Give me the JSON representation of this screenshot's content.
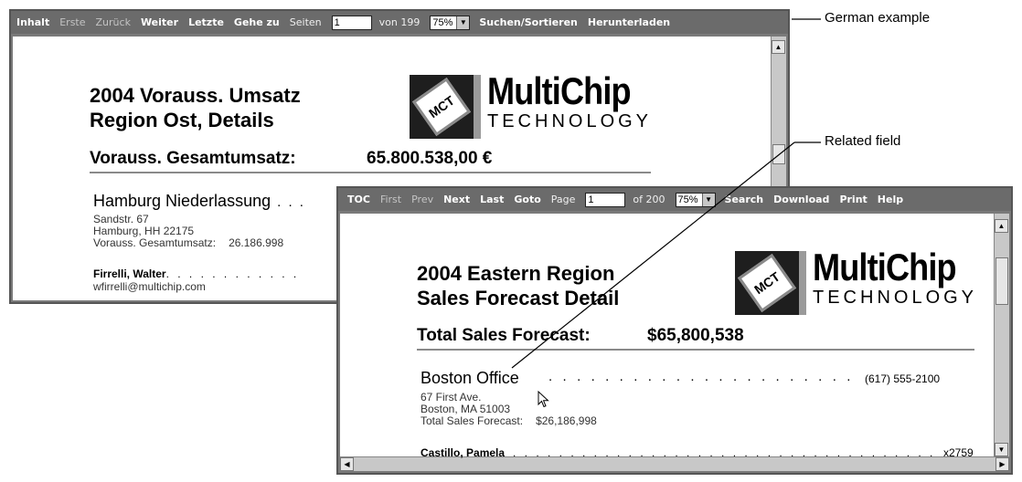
{
  "german_viewer": {
    "toolbar": {
      "toc": "Inhalt",
      "first": "Erste",
      "prev": "Zurück",
      "next": "Weiter",
      "last": "Letzte",
      "goto": "Gehe zu",
      "page_label": "Seiten",
      "page_value": "1",
      "of_label": "von 199",
      "zoom": "75%",
      "search": "Suchen/Sortieren",
      "download": "Herunterladen"
    },
    "doc": {
      "title_line1": "2004 Vorauss. Umsatz",
      "title_line2": "Region Ost, Details",
      "total_label": "Vorauss. Gesamtumsatz:",
      "total_value": "65.800.538,00 €",
      "office_name": "Hamburg  Niederlassung",
      "office_dots": ". . .",
      "address1": "Sandstr. 67",
      "address2": "Hamburg, HH  22175",
      "forecast_label": "Vorauss. Gesamtumsatz:",
      "forecast_value": "26.186.998",
      "contact_name": "Firrelli, Walter",
      "contact_dots": ". . . . . . . . . . . .",
      "contact_email": "wfirrelli@multichip.com"
    }
  },
  "english_viewer": {
    "toolbar": {
      "toc": "TOC",
      "first": "First",
      "prev": "Prev",
      "next": "Next",
      "last": "Last",
      "goto": "Goto",
      "page_label": "Page",
      "page_value": "1",
      "of_label": "of 200",
      "zoom": "75%",
      "search": "Search",
      "download": "Download",
      "print": "Print",
      "help": "Help"
    },
    "doc": {
      "title_line1": "2004 Eastern Region",
      "title_line2": "Sales Forecast Detail",
      "total_label": "Total Sales Forecast:",
      "total_value": "$65,800,538",
      "office_name": "Boston  Office",
      "office_dots": ". . . . . . . . . . . . . . . . . . . . . . . . . . . . . .",
      "office_phone": "(617) 555-2100",
      "address1": "67 First Ave.",
      "address2": "Boston, MA  51003",
      "forecast_label": "Total Sales Forecast:",
      "forecast_value": "$26,186,998",
      "contact_name": "Castillo, Pamela",
      "contact_dots": ". . . . . . . . . . . . . . . . . . . . . . . . . . . . . . . . . . . . . . . . . . . . . .",
      "contact_ext": "x2759"
    }
  },
  "logo": {
    "mark": "MCT",
    "word": "MultiChip",
    "sub": "TECHNOLOGY"
  },
  "callouts": {
    "german": "German example",
    "related": "Related field"
  },
  "colors": {
    "toolbar": "#6b6b6b",
    "rule": "#8a8a8a",
    "logo_dark": "#1e1e1e"
  },
  "icons": {
    "zoom_arrow": "triangle-down-icon",
    "scroll_up": "triangle-up-icon",
    "scroll_down": "triangle-down-icon",
    "cursor": "mouse-pointer-icon"
  }
}
